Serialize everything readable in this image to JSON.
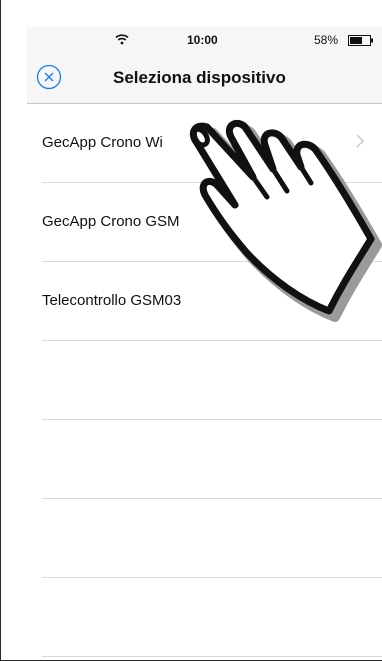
{
  "status_bar": {
    "time": "10:00",
    "battery_percent": "58%",
    "wifi_icon": "wifi-icon",
    "battery_icon": "battery-icon"
  },
  "nav": {
    "title": "Seleziona dispositivo",
    "close_icon": "close-circle-icon",
    "accent_color": "#1a7cf5"
  },
  "devices": [
    {
      "label": "GecApp Crono Wi",
      "has_chevron": true
    },
    {
      "label": "GecApp Crono GSM",
      "has_chevron": false
    },
    {
      "label": "Telecontrollo GSM03",
      "has_chevron": false
    },
    {
      "label": "",
      "has_chevron": false
    },
    {
      "label": "",
      "has_chevron": false
    },
    {
      "label": "",
      "has_chevron": false
    },
    {
      "label": "",
      "has_chevron": false
    }
  ],
  "overlay": {
    "icon": "pointing-hand-icon"
  }
}
